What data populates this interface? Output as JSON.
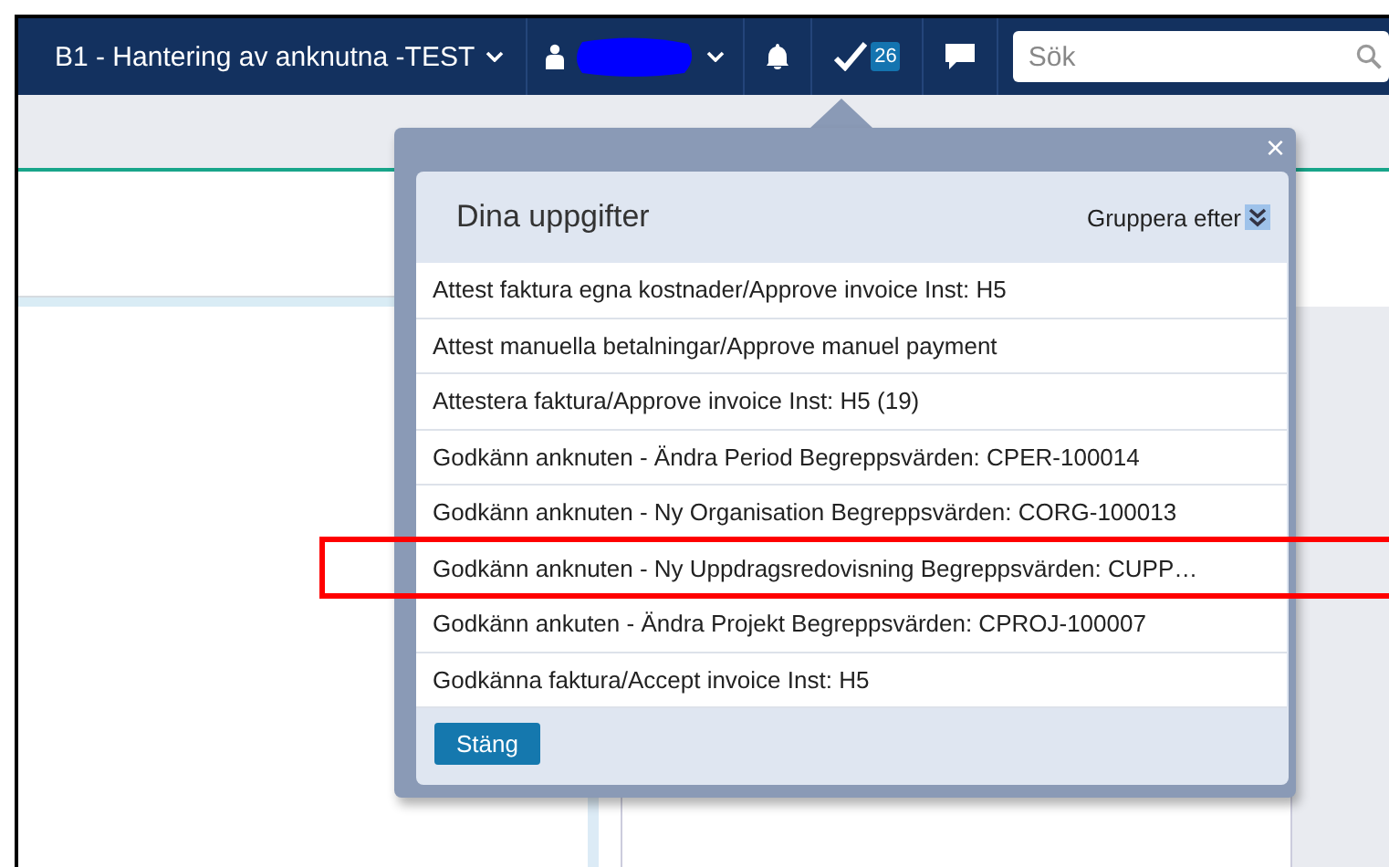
{
  "navbar": {
    "title": "B1 - Hantering av anknutna -TEST",
    "task_count": "26",
    "search": {
      "placeholder": "Sök"
    }
  },
  "tasks_popup": {
    "close_icon": "×",
    "title": "Dina uppgifter",
    "group_by": "Gruppera efter",
    "tasks": [
      "Attest faktura egna kostnader/Approve invoice Inst: H5",
      "Attest manuella betalningar/Approve manuel payment",
      "Attestera faktura/Approve invoice Inst: H5 (19)",
      "Godkänn anknuten - Ändra Period Begreppsvärden: CPER-100014",
      "Godkänn anknuten - Ny Organisation Begreppsvärden: CORG-100013",
      "Godkänn anknuten - Ny Uppdragsredovisning Begreppsvärden: CUPP…",
      "Godkänn ankuten - Ändra Projekt Begreppsvärden: CPROJ-100007",
      "Godkänna faktura/Accept invoice Inst: H5"
    ],
    "close_button": "Stäng"
  }
}
